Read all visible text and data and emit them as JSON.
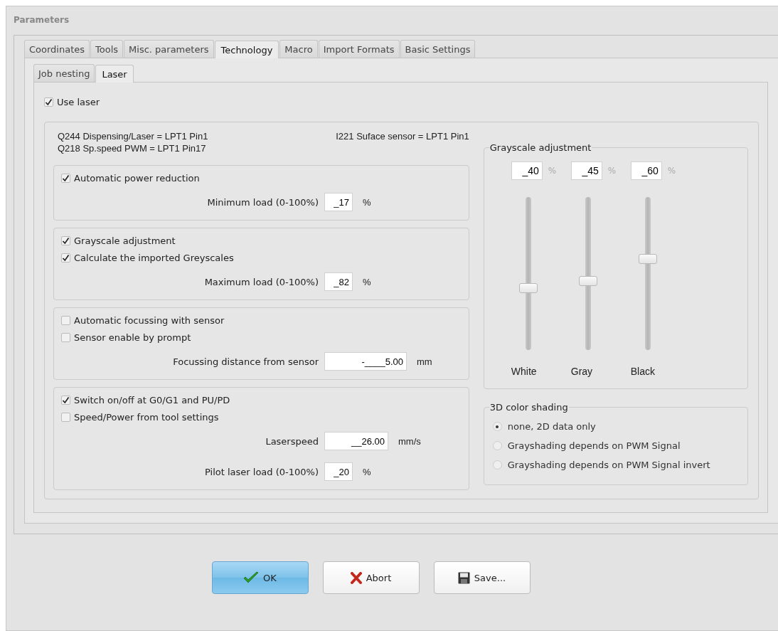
{
  "window": {
    "title": "Parameters"
  },
  "tabs": [
    {
      "label": "Coordinates",
      "selected": false
    },
    {
      "label": "Tools",
      "selected": false
    },
    {
      "label": "Misc. parameters",
      "selected": false
    },
    {
      "label": "Technology",
      "selected": true
    },
    {
      "label": "Macro",
      "selected": false
    },
    {
      "label": "Import Formats",
      "selected": false
    },
    {
      "label": "Basic Settings",
      "selected": false
    }
  ],
  "subtabs": [
    {
      "label": "Job nesting",
      "selected": false
    },
    {
      "label": "Laser",
      "selected": true
    }
  ],
  "use_laser": {
    "label": "Use laser",
    "checked": true
  },
  "io_info": {
    "left": [
      "Q244 Dispensing/Laser = LPT1 Pin1",
      "Q218 Sp.speed PWM = LPT1 Pin17"
    ],
    "right": "I221 Suface sensor = LPT1 Pin1"
  },
  "sections": [
    {
      "checkboxes": [
        {
          "label": "Automatic power reduction",
          "checked": true
        }
      ],
      "fields": [
        {
          "label": "Minimum load (0-100%)",
          "value": "_17",
          "unit": "%",
          "kind": "short"
        }
      ]
    },
    {
      "checkboxes": [
        {
          "label": "Grayscale adjustment",
          "checked": true
        },
        {
          "label": "Calculate the imported Greyscales",
          "checked": true
        }
      ],
      "fields": [
        {
          "label": "Maximum load (0-100%)",
          "value": "_82",
          "unit": "%",
          "kind": "short"
        }
      ]
    },
    {
      "checkboxes": [
        {
          "label": "Automatic focussing with sensor",
          "checked": false
        },
        {
          "label": "Sensor enable by prompt",
          "checked": false
        }
      ],
      "fields": [
        {
          "label": "Focussing distance from sensor",
          "value": "-____5.00",
          "unit": "mm",
          "kind": "long"
        }
      ]
    },
    {
      "checkboxes": [
        {
          "label": "Switch on/off at G0/G1 and PU/PD",
          "checked": true
        },
        {
          "label": "Speed/Power from tool settings",
          "checked": false
        }
      ],
      "fields": [
        {
          "label": "Laserspeed",
          "value": "__26.00",
          "unit": "mm/s",
          "kind": "medium"
        },
        {
          "label": "Pilot laser load (0-100%)",
          "value": "_20",
          "unit": "%",
          "kind": "short"
        }
      ]
    }
  ],
  "grayscale": {
    "title": "Grayscale adjustment",
    "channels": [
      {
        "value": "_40",
        "unit": "%",
        "level": 0.4,
        "label": "White"
      },
      {
        "value": "_45",
        "unit": "%",
        "level": 0.45,
        "label": "Gray"
      },
      {
        "value": "_60",
        "unit": "%",
        "level": 0.6,
        "label": "Black"
      }
    ]
  },
  "shading": {
    "title": "3D color shading",
    "options": [
      {
        "label": "none, 2D data only",
        "selected": true
      },
      {
        "label": "Grayshading depends on PWM Signal",
        "selected": false
      },
      {
        "label": "Grayshading depends on PWM Signal invert",
        "selected": false
      }
    ]
  },
  "buttons": [
    {
      "label": "OK",
      "kind": "ok"
    },
    {
      "label": "Abort",
      "kind": "abort"
    },
    {
      "label": "Save...",
      "kind": "save"
    }
  ]
}
